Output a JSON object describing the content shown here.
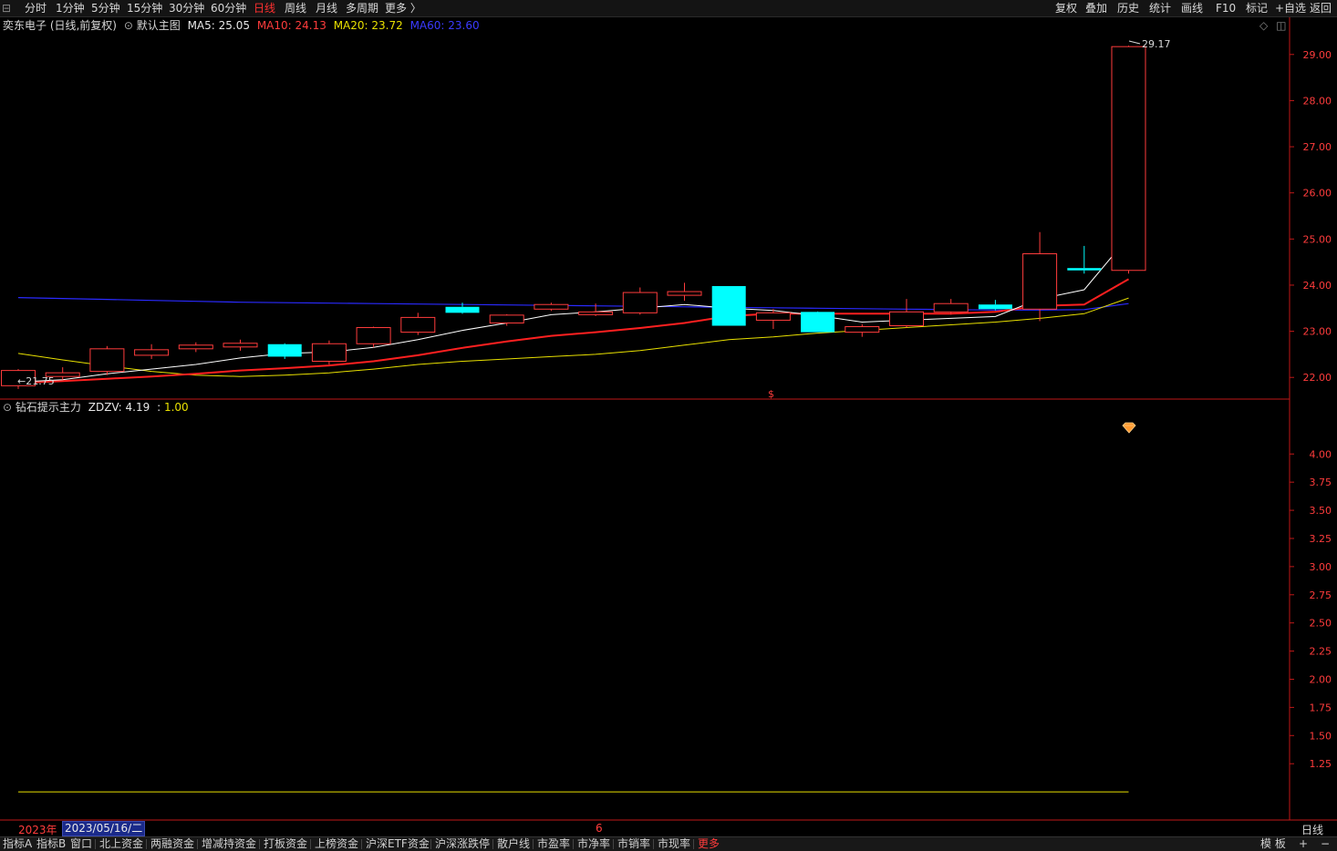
{
  "toolbar": {
    "left": [
      "分时",
      "1分钟",
      "5分钟",
      "15分钟",
      "30分钟",
      "60分钟",
      "日线",
      "周线",
      "月线",
      "多周期",
      "更多 〉"
    ],
    "active": "日线",
    "right": [
      "复权",
      "叠加",
      "历史",
      "统计",
      "画线",
      "F10",
      "标记",
      "+自选",
      "返回"
    ]
  },
  "main_legend": {
    "stock": "奕东电子 (日线,前复权)",
    "template": "默认主图",
    "ma5": "MA5: 25.05",
    "ma10": "MA10: 24.13",
    "ma20": "MA20: 23.72",
    "ma60": "MA60: 23.60"
  },
  "sub_legend": {
    "name": "钻石提示主力",
    "zdzv": "ZDZV: 4.19",
    "sep": ":",
    "value": "1.00"
  },
  "colors": {
    "up": "#ff3c3c",
    "down": "#00ffff",
    "ma5": "#ffffff",
    "ma10": "#ff2020",
    "ma20": "#e8e000",
    "ma60": "#2a2aff",
    "axis": "#c01818"
  },
  "chart_data": {
    "type": "candlestick",
    "main_axis": {
      "ylim": [
        21.55,
        29.45
      ],
      "ticks": [
        "29.00",
        "28.00",
        "27.00",
        "26.00",
        "25.00",
        "24.00",
        "23.00",
        "22.00"
      ]
    },
    "sub_axis": {
      "ylim": [
        0.75,
        4.35
      ],
      "ticks": [
        "4.00",
        "3.75",
        "3.50",
        "3.25",
        "3.00",
        "2.75",
        "2.50",
        "2.25",
        "2.00",
        "1.75",
        "1.50",
        "1.25"
      ]
    },
    "candles": [
      {
        "o": 21.82,
        "h": 22.18,
        "l": 21.75,
        "c": 22.15
      },
      {
        "o": 22.02,
        "h": 22.22,
        "l": 21.95,
        "c": 22.1
      },
      {
        "o": 22.13,
        "h": 22.68,
        "l": 22.05,
        "c": 22.62
      },
      {
        "o": 22.48,
        "h": 22.72,
        "l": 22.4,
        "c": 22.6
      },
      {
        "o": 22.62,
        "h": 22.76,
        "l": 22.55,
        "c": 22.7
      },
      {
        "o": 22.66,
        "h": 22.82,
        "l": 22.58,
        "c": 22.74
      },
      {
        "o": 22.72,
        "h": 22.74,
        "l": 22.4,
        "c": 22.45
      },
      {
        "o": 22.35,
        "h": 22.8,
        "l": 22.28,
        "c": 22.73
      },
      {
        "o": 22.73,
        "h": 23.1,
        "l": 22.65,
        "c": 23.08
      },
      {
        "o": 22.98,
        "h": 23.4,
        "l": 22.92,
        "c": 23.3
      },
      {
        "o": 23.53,
        "h": 23.62,
        "l": 23.38,
        "c": 23.4
      },
      {
        "o": 23.18,
        "h": 23.37,
        "l": 23.12,
        "c": 23.35
      },
      {
        "o": 23.48,
        "h": 23.62,
        "l": 23.44,
        "c": 23.58
      },
      {
        "o": 23.36,
        "h": 23.6,
        "l": 23.33,
        "c": 23.42
      },
      {
        "o": 23.4,
        "h": 23.95,
        "l": 23.36,
        "c": 23.84
      },
      {
        "o": 23.78,
        "h": 24.05,
        "l": 23.66,
        "c": 23.86
      },
      {
        "o": 23.98,
        "h": 23.98,
        "l": 23.12,
        "c": 23.12
      },
      {
        "o": 23.24,
        "h": 23.48,
        "l": 23.05,
        "c": 23.4
      },
      {
        "o": 23.42,
        "h": 23.43,
        "l": 22.98,
        "c": 22.98
      },
      {
        "o": 22.98,
        "h": 23.15,
        "l": 22.88,
        "c": 23.1
      },
      {
        "o": 23.12,
        "h": 23.7,
        "l": 23.08,
        "c": 23.42
      },
      {
        "o": 23.42,
        "h": 23.7,
        "l": 23.36,
        "c": 23.6
      },
      {
        "o": 23.58,
        "h": 23.68,
        "l": 23.45,
        "c": 23.48
      },
      {
        "o": 23.48,
        "h": 25.15,
        "l": 23.22,
        "c": 24.68
      },
      {
        "o": 24.37,
        "h": 24.85,
        "l": 24.25,
        "c": 24.32
      },
      {
        "o": 24.32,
        "h": 29.19,
        "l": 24.25,
        "c": 29.17
      }
    ],
    "ma5": [
      21.9,
      21.95,
      22.08,
      22.18,
      22.28,
      22.42,
      22.52,
      22.55,
      22.65,
      22.82,
      23.02,
      23.18,
      23.36,
      23.42,
      23.5,
      23.58,
      23.5,
      23.45,
      23.34,
      23.2,
      23.24,
      23.28,
      23.32,
      23.7,
      23.9,
      25.05
    ],
    "ma10": [
      21.88,
      21.92,
      21.97,
      22.02,
      22.08,
      22.15,
      22.2,
      22.26,
      22.35,
      22.48,
      22.64,
      22.78,
      22.9,
      22.98,
      23.07,
      23.18,
      23.33,
      23.38,
      23.38,
      23.38,
      23.38,
      23.38,
      23.42,
      23.55,
      23.58,
      24.13
    ],
    "ma20": [
      22.52,
      22.38,
      22.25,
      22.13,
      22.05,
      22.02,
      22.05,
      22.1,
      22.18,
      22.28,
      22.35,
      22.4,
      22.45,
      22.5,
      22.58,
      22.7,
      22.82,
      22.88,
      22.96,
      23.02,
      23.08,
      23.14,
      23.2,
      23.28,
      23.38,
      23.72
    ],
    "ma60": [
      23.73,
      23.71,
      23.69,
      23.67,
      23.65,
      23.63,
      23.62,
      23.61,
      23.6,
      23.59,
      23.58,
      23.57,
      23.56,
      23.55,
      23.54,
      23.53,
      23.52,
      23.51,
      23.5,
      23.49,
      23.48,
      23.47,
      23.46,
      23.46,
      23.47,
      23.6
    ],
    "zdzv_line": 1.0,
    "annotations": {
      "low": "21.75",
      "high": "29.17"
    }
  },
  "bottom": {
    "year": "2023年",
    "date": "2023/05/16/二",
    "month_mark": "6",
    "period": "日线",
    "tabs": [
      "指标A",
      "指标B",
      "窗口",
      "北上资金",
      "两融资金",
      "增减持资金",
      "打板资金",
      "上榜资金",
      "沪深ETF资金",
      "沪深涨跌停",
      "散户线",
      "市盈率",
      "市净率",
      "市销率",
      "市现率",
      "更多"
    ],
    "right": [
      "模 板",
      "+",
      "−"
    ]
  }
}
